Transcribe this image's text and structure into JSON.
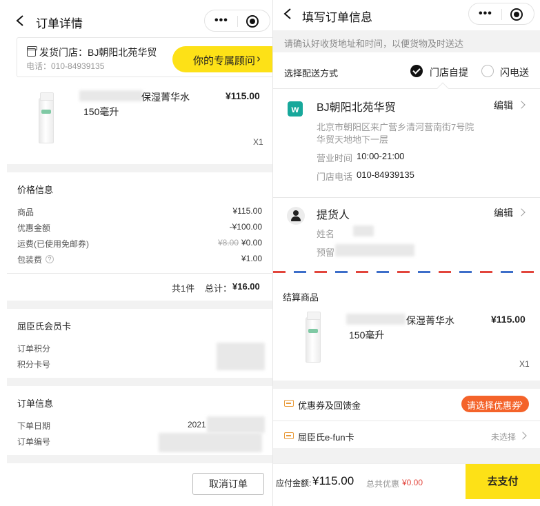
{
  "left": {
    "nav_title": "订单详情",
    "store": {
      "label": "发货门店：BJ朝阳北苑华贸",
      "phone": "电话：010-84939135"
    },
    "advisor_button": "你的专属顾问",
    "advisor_arrow": "›",
    "product": {
      "name_suffix": "保湿菁华水",
      "name_line2": "150毫升",
      "price": "¥115.00",
      "qty": "X1"
    },
    "price_section": {
      "title": "价格信息",
      "rows": [
        {
          "label": "商品",
          "value": "¥115.00",
          "strike": ""
        },
        {
          "label": "优惠金额",
          "value": "-¥100.00",
          "strike": ""
        },
        {
          "label": "运费(已使用免邮券)",
          "value": "¥0.00",
          "strike": "¥8.00"
        },
        {
          "label": "包装费",
          "value": "¥1.00",
          "strike": ""
        }
      ],
      "help_icon": "?",
      "summary_count": "共1件",
      "summary_total_label": "总计：",
      "summary_total": "¥16.00"
    },
    "member_section": {
      "title": "屈臣氏会员卡",
      "points_label": "订单积分",
      "card_label": "积分卡号"
    },
    "order_section": {
      "title": "订单信息",
      "date_label": "下单日期",
      "date_value": "2021",
      "number_label": "订单编号"
    },
    "cancel_button": "取消订单"
  },
  "right": {
    "nav_title": "填写订单信息",
    "notice": "请确认好收货地址和时间，以便货物及时送达",
    "delivery": {
      "label": "选择配送方式",
      "option_pickup": "门店自提",
      "option_flash": "闪电送",
      "selected": "门店自提"
    },
    "store": {
      "logo": "w",
      "name": "BJ朝阳北苑华贸",
      "edit": "编辑",
      "address_line1": "北京市朝阳区来广营乡清河营南街7号院",
      "address_line2": "华贸天地地下一层",
      "hours_label": "营业时间",
      "hours_value": "10:00-21:00",
      "phone_label": "门店电话",
      "phone_value": "010-84939135"
    },
    "pickup": {
      "title": "提货人",
      "edit": "编辑",
      "name_label": "姓名",
      "reserve_label": "预留"
    },
    "checkout": {
      "title": "结算商品",
      "name_suffix": "保湿菁华水",
      "name_line2": "150毫升",
      "price": "¥115.00",
      "qty": "X1"
    },
    "coupon": {
      "label": "优惠券及回馈金",
      "button": "请选择优惠券",
      "arrow": "›"
    },
    "efun": {
      "label": "屈臣氏e-fun卡",
      "value": "未选择"
    },
    "bottom": {
      "pay_label": "应付金额:",
      "pay_amount": "¥115.00",
      "discount_label": "总共优惠",
      "discount_amount": "¥0.00",
      "pay_button": "去支付"
    }
  },
  "colors": {
    "brand_yellow": "#fde117",
    "accent_orange": "#f4632a",
    "brand_teal": "#17a89b",
    "discount_red": "#e2453c"
  }
}
